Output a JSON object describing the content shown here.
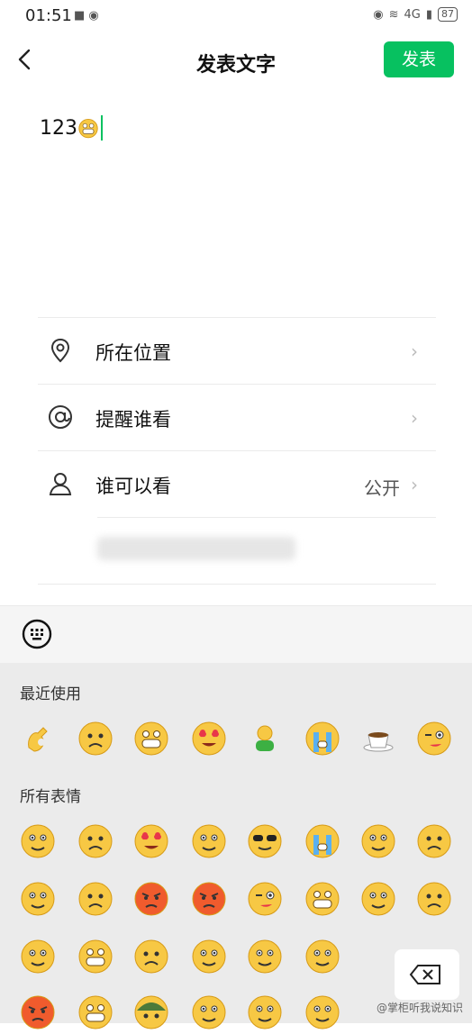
{
  "status": {
    "time": "01:51",
    "battery": "87",
    "network": "4G"
  },
  "header": {
    "title": "发表文字",
    "publish_label": "发表"
  },
  "compose": {
    "text": "123"
  },
  "menu": {
    "location": {
      "label": "所在位置"
    },
    "remind": {
      "label": "提醒谁看"
    },
    "visibility": {
      "label": "谁可以看",
      "value": "公开"
    }
  },
  "emoji_panel": {
    "recent_title": "最近使用",
    "all_title": "所有表情",
    "colors": {
      "accent": "#07c160",
      "panel_bg": "#ebebeb"
    }
  },
  "watermark": "@掌柜听我说知识"
}
